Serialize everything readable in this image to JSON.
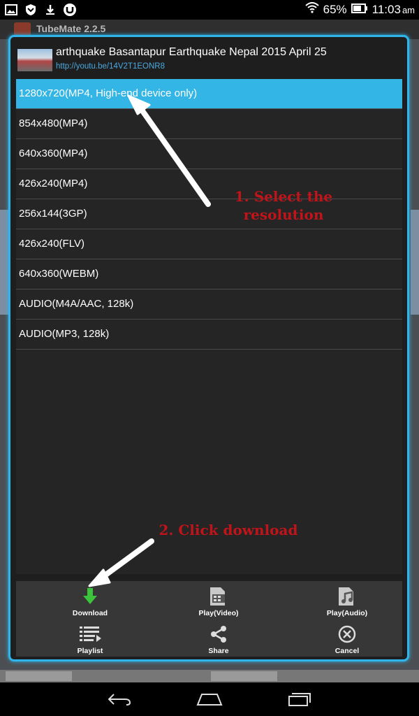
{
  "status_bar": {
    "battery_percent": "65%",
    "time": "11:03",
    "ampm": "am",
    "icons": [
      "image-icon",
      "shield-icon",
      "download-notify-icon",
      "utorrent-icon",
      "wifi-icon",
      "battery-icon"
    ]
  },
  "background_app": {
    "title": "TubeMate 2.2.5"
  },
  "dialog": {
    "video_title": "arthquake Basantapur Earthquake Nepal 2015 April 25",
    "video_url": "http://youtu.be/14V2T1EONR8",
    "resolutions": [
      {
        "label": "1280x720(MP4, High-end device only)",
        "selected": true
      },
      {
        "label": "854x480(MP4)",
        "selected": false
      },
      {
        "label": "640x360(MP4)",
        "selected": false
      },
      {
        "label": "426x240(MP4)",
        "selected": false
      },
      {
        "label": "256x144(3GP)",
        "selected": false
      },
      {
        "label": "426x240(FLV)",
        "selected": false
      },
      {
        "label": "640x360(WEBM)",
        "selected": false
      },
      {
        "label": "AUDIO(M4A/AAC, 128k)",
        "selected": false
      },
      {
        "label": "AUDIO(MP3, 128k)",
        "selected": false
      }
    ],
    "toolbar": {
      "download": "Download",
      "play_video": "Play(Video)",
      "play_audio": "Play(Audio)",
      "playlist": "Playlist",
      "share": "Share",
      "cancel": "Cancel"
    }
  },
  "annotations": {
    "step1_line1": "1. Select the",
    "step1_line2": "resolution",
    "step2": "2. Click download"
  },
  "colors": {
    "accent": "#33b5e5",
    "annotation": "#c0141a",
    "download_green": "#3cc43c"
  }
}
